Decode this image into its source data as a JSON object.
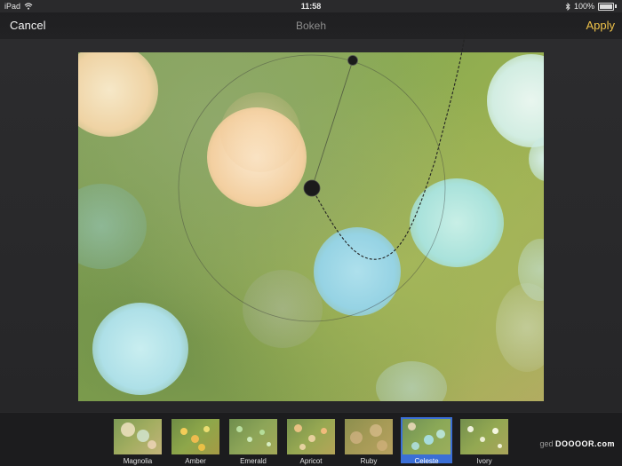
{
  "status": {
    "device": "iPad",
    "time": "11:58",
    "battery": "100%"
  },
  "nav": {
    "cancel": "Cancel",
    "title": "Bokeh",
    "apply": "Apply"
  },
  "filters": [
    {
      "label": "Magnolia",
      "selected": false
    },
    {
      "label": "Amber",
      "selected": false
    },
    {
      "label": "Emerald",
      "selected": false
    },
    {
      "label": "Apricot",
      "selected": false
    },
    {
      "label": "Ruby",
      "selected": false
    },
    {
      "label": "Celeste",
      "selected": true
    },
    {
      "label": "Ivory",
      "selected": false
    }
  ],
  "watermark": {
    "left": "ged",
    "right": "DOOOOR.com"
  },
  "colors": {
    "accent": "#f0c34a",
    "selection": "#3b6fd6"
  }
}
